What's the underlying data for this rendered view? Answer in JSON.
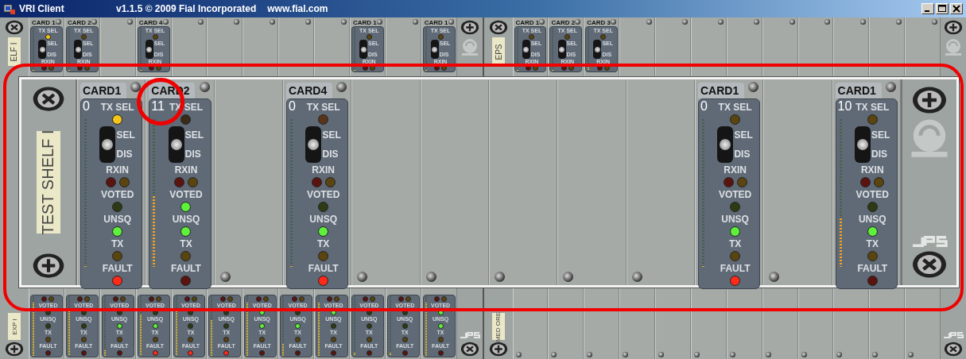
{
  "window": {
    "title": "VRI Client",
    "version": "v1.1.5  © 2009 Fial Incorporated",
    "website": "www.fial.com"
  },
  "background": {
    "top": [
      {
        "label": "ELF I",
        "slots": [
          {
            "kind": "card",
            "title": "CARD 1",
            "level": 0,
            "items": [
              {
                "kind": "label",
                "text": "TX SEL"
              },
              {
                "kind": "led",
                "color": "#f5c518"
              },
              {
                "kind": "switch",
                "level": 0.5,
                "labels": [
                  "SEL",
                  "DIS"
                ]
              },
              {
                "kind": "label",
                "text": "RXIN"
              },
              {
                "kind": "led_pair",
                "leds": [
                  {
                    "color": "#5a1410"
                  },
                  {
                    "color": "#5a4410"
                  }
                ]
              }
            ]
          },
          {
            "kind": "card",
            "title": "CARD 2",
            "level": 0,
            "items": [
              {
                "kind": "label",
                "text": "TX SEL"
              },
              {
                "kind": "led",
                "color": "#5a4410"
              },
              {
                "kind": "switch",
                "level": 0.5,
                "labels": [
                  "SEL",
                  "DIS"
                ]
              },
              {
                "kind": "label",
                "text": "RXIN"
              },
              {
                "kind": "led_pair",
                "leds": [
                  {
                    "color": "#5a1410"
                  },
                  {
                    "color": "#5a4410"
                  }
                ]
              }
            ]
          },
          {
            "kind": "empty"
          },
          {
            "kind": "card",
            "title": "CARD 4",
            "level": 0,
            "items": [
              {
                "kind": "label",
                "text": "TX SEL"
              },
              {
                "kind": "led",
                "color": "#5a4410"
              },
              {
                "kind": "switch",
                "level": 0.5,
                "labels": [
                  "SEL",
                  "DIS"
                ]
              },
              {
                "kind": "label",
                "text": "RXIN"
              },
              {
                "kind": "led_pair",
                "leds": [
                  {
                    "color": "#5a1410"
                  },
                  {
                    "color": "#5a4410"
                  }
                ]
              }
            ]
          },
          {
            "kind": "empty"
          },
          {
            "kind": "empty"
          },
          {
            "kind": "empty"
          },
          {
            "kind": "empty"
          },
          {
            "kind": "empty"
          },
          {
            "kind": "card",
            "title": "CARD 1",
            "level": 0,
            "items": [
              {
                "kind": "label",
                "text": "TX SEL"
              },
              {
                "kind": "led",
                "color": "#5a4410"
              },
              {
                "kind": "switch",
                "level": 0.5,
                "labels": [
                  "SEL",
                  "DIS"
                ]
              },
              {
                "kind": "label",
                "text": "RXIN"
              },
              {
                "kind": "led_pair",
                "leds": [
                  {
                    "color": "#5a1410"
                  },
                  {
                    "color": "#5a4410"
                  }
                ]
              }
            ]
          },
          {
            "kind": "empty"
          },
          {
            "kind": "card",
            "title": "CARD 1",
            "level": 0,
            "items": [
              {
                "kind": "label",
                "text": "TX SEL"
              },
              {
                "kind": "led",
                "color": "#5a4410"
              },
              {
                "kind": "switch",
                "level": 0.5,
                "labels": [
                  "SEL",
                  "DIS"
                ]
              },
              {
                "kind": "label",
                "text": "RXIN"
              },
              {
                "kind": "led_pair",
                "leds": [
                  {
                    "color": "#5a1410"
                  },
                  {
                    "color": "#5a4410"
                  }
                ]
              }
            ]
          }
        ]
      },
      {
        "label": "EPS",
        "slots": [
          {
            "kind": "card",
            "title": "CARD 1",
            "level": 0,
            "items": [
              {
                "kind": "label",
                "text": "TX SEL"
              },
              {
                "kind": "led",
                "color": "#5a4410"
              },
              {
                "kind": "switch",
                "level": 0.5,
                "labels": [
                  "SEL",
                  "DIS"
                ]
              },
              {
                "kind": "label",
                "text": "RXIN"
              },
              {
                "kind": "led_pair",
                "leds": [
                  {
                    "color": "#5a1410"
                  },
                  {
                    "color": "#5a4410"
                  }
                ]
              }
            ]
          },
          {
            "kind": "card",
            "title": "CARD 2",
            "level": 0,
            "items": [
              {
                "kind": "label",
                "text": "TX SEL"
              },
              {
                "kind": "led",
                "color": "#5a4410"
              },
              {
                "kind": "switch",
                "level": 0.5,
                "labels": [
                  "SEL",
                  "DIS"
                ]
              },
              {
                "kind": "label",
                "text": "RXIN"
              },
              {
                "kind": "led_pair",
                "leds": [
                  {
                    "color": "#5a1410"
                  },
                  {
                    "color": "#5a4410"
                  }
                ]
              }
            ]
          },
          {
            "kind": "card",
            "title": "CARD 3",
            "level": 0.15,
            "items": [
              {
                "kind": "label",
                "text": "TX SEL"
              },
              {
                "kind": "led",
                "color": "#5a4410"
              },
              {
                "kind": "switch",
                "level": 0.5,
                "labels": [
                  "SEL",
                  "DIS"
                ]
              },
              {
                "kind": "label",
                "text": "RXIN"
              },
              {
                "kind": "led_pair",
                "leds": [
                  {
                    "color": "#5a1410"
                  },
                  {
                    "color": "#5a4410"
                  }
                ]
              }
            ]
          },
          {
            "kind": "empty"
          },
          {
            "kind": "empty"
          },
          {
            "kind": "empty"
          },
          {
            "kind": "empty"
          },
          {
            "kind": "empty"
          },
          {
            "kind": "empty"
          },
          {
            "kind": "empty"
          },
          {
            "kind": "empty"
          },
          {
            "kind": "empty"
          }
        ]
      }
    ],
    "bottom": [
      {
        "label": "EXP I",
        "slots": [
          {
            "kind": "card",
            "level": 0.9,
            "items": [
              {
                "kind": "led_pair",
                "leds": [
                  {
                    "color": "#5a1410"
                  },
                  {
                    "color": "#5a4410"
                  }
                ]
              },
              {
                "kind": "label",
                "text": "VOTED"
              },
              {
                "kind": "led",
                "color": "#2e3a14"
              },
              {
                "kind": "label",
                "text": "UNSQ"
              },
              {
                "kind": "led",
                "color": "#2e3a14"
              },
              {
                "kind": "label",
                "text": "TX"
              },
              {
                "kind": "led",
                "color": "#5a4410"
              },
              {
                "kind": "label",
                "text": "FAULT"
              },
              {
                "kind": "led",
                "color": "#5a1410"
              }
            ]
          },
          {
            "kind": "card",
            "level": 0.8,
            "items": [
              {
                "kind": "led_pair",
                "leds": [
                  {
                    "color": "#5a1410"
                  },
                  {
                    "color": "#5a4410"
                  }
                ]
              },
              {
                "kind": "label",
                "text": "VOTED"
              },
              {
                "kind": "led",
                "color": "#2e3a14"
              },
              {
                "kind": "label",
                "text": "UNSQ"
              },
              {
                "kind": "led",
                "color": "#2e3a14"
              },
              {
                "kind": "label",
                "text": "TX"
              },
              {
                "kind": "led",
                "color": "#5a4410"
              },
              {
                "kind": "label",
                "text": "FAULT"
              },
              {
                "kind": "led",
                "color": "#5a1410"
              }
            ]
          },
          {
            "kind": "card",
            "level": 0.1,
            "items": [
              {
                "kind": "led_pair",
                "leds": [
                  {
                    "color": "#5a1410"
                  },
                  {
                    "color": "#5a4410"
                  }
                ]
              },
              {
                "kind": "label",
                "text": "VOTED"
              },
              {
                "kind": "led",
                "color": "#2e3a14"
              },
              {
                "kind": "label",
                "text": "UNSQ"
              },
              {
                "kind": "led",
                "color": "#5ef03a"
              },
              {
                "kind": "label",
                "text": "TX"
              },
              {
                "kind": "led",
                "color": "#5a4410"
              },
              {
                "kind": "label",
                "text": "FAULT"
              },
              {
                "kind": "led",
                "color": "#5a1410"
              }
            ]
          },
          {
            "kind": "card",
            "level": 0.7,
            "items": [
              {
                "kind": "led_pair",
                "leds": [
                  {
                    "color": "#5a1410"
                  },
                  {
                    "color": "#5a4410"
                  }
                ]
              },
              {
                "kind": "label",
                "text": "VOTED"
              },
              {
                "kind": "led",
                "color": "#2e3a14"
              },
              {
                "kind": "label",
                "text": "UNSQ"
              },
              {
                "kind": "led",
                "color": "#5ef03a"
              },
              {
                "kind": "label",
                "text": "TX"
              },
              {
                "kind": "led",
                "color": "#5a4410"
              },
              {
                "kind": "label",
                "text": "FAULT"
              },
              {
                "kind": "led",
                "color": "#ff2a1a"
              }
            ]
          },
          {
            "kind": "card",
            "level": 0.8,
            "items": [
              {
                "kind": "led_pair",
                "leds": [
                  {
                    "color": "#5a1410"
                  },
                  {
                    "color": "#5a4410"
                  }
                ]
              },
              {
                "kind": "label",
                "text": "VOTED"
              },
              {
                "kind": "led",
                "color": "#2e3a14"
              },
              {
                "kind": "label",
                "text": "UNSQ"
              },
              {
                "kind": "led",
                "color": "#2e3a14"
              },
              {
                "kind": "label",
                "text": "TX"
              },
              {
                "kind": "led",
                "color": "#5a4410"
              },
              {
                "kind": "label",
                "text": "FAULT"
              },
              {
                "kind": "led",
                "color": "#ff2a1a"
              }
            ]
          },
          {
            "kind": "card",
            "level": 0.6,
            "items": [
              {
                "kind": "led_pair",
                "leds": [
                  {
                    "color": "#5a1410"
                  },
                  {
                    "color": "#5a4410"
                  }
                ]
              },
              {
                "kind": "label",
                "text": "VOTED"
              },
              {
                "kind": "led",
                "color": "#2e3a14"
              },
              {
                "kind": "label",
                "text": "UNSQ"
              },
              {
                "kind": "led",
                "color": "#2e3a14"
              },
              {
                "kind": "label",
                "text": "TX"
              },
              {
                "kind": "led",
                "color": "#5a4410"
              },
              {
                "kind": "label",
                "text": "FAULT"
              },
              {
                "kind": "led",
                "color": "#ff2a1a"
              }
            ]
          },
          {
            "kind": "card",
            "level": 0.9,
            "items": [
              {
                "kind": "led_pair",
                "leds": [
                  {
                    "color": "#5a1410"
                  },
                  {
                    "color": "#5a4410"
                  }
                ]
              },
              {
                "kind": "label",
                "text": "VOTED"
              },
              {
                "kind": "led",
                "color": "#5ef03a"
              },
              {
                "kind": "label",
                "text": "UNSQ"
              },
              {
                "kind": "led",
                "color": "#5ef03a"
              },
              {
                "kind": "label",
                "text": "TX"
              },
              {
                "kind": "led",
                "color": "#5a4410"
              },
              {
                "kind": "label",
                "text": "FAULT"
              },
              {
                "kind": "led",
                "color": "#5a1410"
              }
            ]
          },
          {
            "kind": "card",
            "level": 0.2,
            "items": [
              {
                "kind": "led_pair",
                "leds": [
                  {
                    "color": "#5a1410"
                  },
                  {
                    "color": "#5a4410"
                  }
                ]
              },
              {
                "kind": "label",
                "text": "VOTED"
              },
              {
                "kind": "led",
                "color": "#2e3a14"
              },
              {
                "kind": "label",
                "text": "UNSQ"
              },
              {
                "kind": "led",
                "color": "#5ef03a"
              },
              {
                "kind": "label",
                "text": "TX"
              },
              {
                "kind": "led",
                "color": "#5a4410"
              },
              {
                "kind": "label",
                "text": "FAULT"
              },
              {
                "kind": "led",
                "color": "#5a1410"
              }
            ]
          },
          {
            "kind": "card",
            "level": 0.9,
            "items": [
              {
                "kind": "led_pair",
                "leds": [
                  {
                    "color": "#5a1410"
                  },
                  {
                    "color": "#5a4410"
                  }
                ]
              },
              {
                "kind": "label",
                "text": "VOTED"
              },
              {
                "kind": "led",
                "color": "#5ef03a"
              },
              {
                "kind": "label",
                "text": "UNSQ"
              },
              {
                "kind": "led",
                "color": "#2e3a14"
              },
              {
                "kind": "label",
                "text": "TX"
              },
              {
                "kind": "led",
                "color": "#5a4410"
              },
              {
                "kind": "label",
                "text": "FAULT"
              },
              {
                "kind": "led",
                "color": "#5a1410"
              }
            ]
          },
          {
            "kind": "card",
            "level": 0.05,
            "items": [
              {
                "kind": "led_pair",
                "leds": [
                  {
                    "color": "#5a1410"
                  },
                  {
                    "color": "#5a4410"
                  }
                ]
              },
              {
                "kind": "label",
                "text": "VOTED"
              },
              {
                "kind": "led",
                "color": "#2e3a14"
              },
              {
                "kind": "label",
                "text": "UNSQ"
              },
              {
                "kind": "led",
                "color": "#2e3a14"
              },
              {
                "kind": "label",
                "text": "TX"
              },
              {
                "kind": "led",
                "color": "#5a4410"
              },
              {
                "kind": "label",
                "text": "FAULT"
              },
              {
                "kind": "led",
                "color": "#5a1410"
              }
            ]
          },
          {
            "kind": "card",
            "level": 0.05,
            "items": [
              {
                "kind": "led_pair",
                "leds": [
                  {
                    "color": "#5a1410"
                  },
                  {
                    "color": "#5a4410"
                  }
                ]
              },
              {
                "kind": "label",
                "text": "VOTED"
              },
              {
                "kind": "led",
                "color": "#2e3a14"
              },
              {
                "kind": "label",
                "text": "UNSQ"
              },
              {
                "kind": "led",
                "color": "#2e3a14"
              },
              {
                "kind": "label",
                "text": "TX"
              },
              {
                "kind": "led",
                "color": "#5a4410"
              },
              {
                "kind": "label",
                "text": "FAULT"
              },
              {
                "kind": "led",
                "color": "#5a1410"
              }
            ]
          },
          {
            "kind": "card",
            "level": 0.9,
            "items": [
              {
                "kind": "led_pair",
                "leds": [
                  {
                    "color": "#5a1410"
                  },
                  {
                    "color": "#5a4410"
                  }
                ]
              },
              {
                "kind": "label",
                "text": "VOTED"
              },
              {
                "kind": "led",
                "color": "#5ef03a"
              },
              {
                "kind": "label",
                "text": "UNSQ"
              },
              {
                "kind": "led",
                "color": "#5ef03a"
              },
              {
                "kind": "label",
                "text": "TX"
              },
              {
                "kind": "led",
                "color": "#5a4410"
              },
              {
                "kind": "label",
                "text": "FAULT"
              },
              {
                "kind": "led",
                "color": "#5a1410"
              }
            ]
          }
        ]
      },
      {
        "label": "MED ORE",
        "slots": [
          {
            "kind": "empty"
          },
          {
            "kind": "empty"
          },
          {
            "kind": "empty"
          },
          {
            "kind": "empty"
          },
          {
            "kind": "empty"
          },
          {
            "kind": "empty"
          },
          {
            "kind": "empty"
          },
          {
            "kind": "empty"
          },
          {
            "kind": "empty"
          },
          {
            "kind": "empty"
          },
          {
            "kind": "empty"
          },
          {
            "kind": "empty"
          }
        ]
      }
    ]
  },
  "zoomed_shelf": {
    "label": "TEST SHELF I",
    "slots": [
      {
        "kind": "card",
        "title": "CARD1",
        "number": "0",
        "level": 0,
        "items": [
          {
            "kind": "label",
            "text": "TX SEL"
          },
          {
            "kind": "led",
            "color": "#f5c518"
          },
          {
            "kind": "switch",
            "level": 0.5,
            "labels": [
              "SEL",
              "DIS"
            ]
          },
          {
            "kind": "label",
            "text": "RXIN"
          },
          {
            "kind": "led_pair",
            "leds": [
              {
                "color": "#5a1410"
              },
              {
                "color": "#5a4410"
              }
            ]
          },
          {
            "kind": "label",
            "text": "VOTED"
          },
          {
            "kind": "led",
            "color": "#2e3a14"
          },
          {
            "kind": "label",
            "text": "UNSQ"
          },
          {
            "kind": "led",
            "color": "#5ef03a"
          },
          {
            "kind": "label",
            "text": "TX"
          },
          {
            "kind": "led",
            "color": "#5a4410"
          },
          {
            "kind": "label",
            "text": "FAULT"
          },
          {
            "kind": "led",
            "color": "#ff2a1a"
          }
        ]
      },
      {
        "kind": "card",
        "title": "CARD2",
        "number": "11",
        "level": 0.48,
        "items": [
          {
            "kind": "label",
            "text": "TX SEL"
          },
          {
            "kind": "led",
            "color": "#3a2a18"
          },
          {
            "kind": "switch",
            "level": 0.5,
            "labels": [
              "SEL",
              "DIS"
            ]
          },
          {
            "kind": "label",
            "text": "RXIN"
          },
          {
            "kind": "led_pair",
            "leds": [
              {
                "color": "#5a1410"
              },
              {
                "color": "#5a4410"
              }
            ]
          },
          {
            "kind": "label",
            "text": "VOTED"
          },
          {
            "kind": "led",
            "color": "#5ef03a"
          },
          {
            "kind": "label",
            "text": "UNSQ"
          },
          {
            "kind": "led",
            "color": "#5ef03a"
          },
          {
            "kind": "label",
            "text": "TX"
          },
          {
            "kind": "led",
            "color": "#5a4410"
          },
          {
            "kind": "label",
            "text": "FAULT"
          },
          {
            "kind": "led",
            "color": "#5a1410"
          }
        ]
      },
      {
        "kind": "empty"
      },
      {
        "kind": "card",
        "title": "CARD4",
        "number": "0",
        "level": 0,
        "items": [
          {
            "kind": "label",
            "text": "TX SEL"
          },
          {
            "kind": "led",
            "color": "#5a3418"
          },
          {
            "kind": "switch",
            "level": 0.5,
            "labels": [
              "SEL",
              "DIS"
            ]
          },
          {
            "kind": "label",
            "text": "RXIN"
          },
          {
            "kind": "led_pair",
            "leds": [
              {
                "color": "#5a1410"
              },
              {
                "color": "#5a4410"
              }
            ]
          },
          {
            "kind": "label",
            "text": "VOTED"
          },
          {
            "kind": "led",
            "color": "#2e3a14"
          },
          {
            "kind": "label",
            "text": "UNSQ"
          },
          {
            "kind": "led",
            "color": "#5ef03a"
          },
          {
            "kind": "label",
            "text": "TX"
          },
          {
            "kind": "led",
            "color": "#5a4410"
          },
          {
            "kind": "label",
            "text": "FAULT"
          },
          {
            "kind": "led",
            "color": "#ff2a1a"
          }
        ]
      },
      {
        "kind": "empty"
      },
      {
        "kind": "empty"
      },
      {
        "kind": "empty"
      },
      {
        "kind": "empty"
      },
      {
        "kind": "empty"
      },
      {
        "kind": "card",
        "title": "CARD1",
        "number": "0",
        "level": 0,
        "items": [
          {
            "kind": "label",
            "text": "TX SEL"
          },
          {
            "kind": "led",
            "color": "#5a4410"
          },
          {
            "kind": "switch",
            "level": 0.5,
            "labels": [
              "SEL",
              "DIS"
            ]
          },
          {
            "kind": "label",
            "text": "RXIN"
          },
          {
            "kind": "led_pair",
            "leds": [
              {
                "color": "#5a1410"
              },
              {
                "color": "#5a4410"
              }
            ]
          },
          {
            "kind": "label",
            "text": "VOTED"
          },
          {
            "kind": "led",
            "color": "#2e3a14"
          },
          {
            "kind": "label",
            "text": "UNSQ"
          },
          {
            "kind": "led",
            "color": "#5ef03a"
          },
          {
            "kind": "label",
            "text": "TX"
          },
          {
            "kind": "led",
            "color": "#5a4410"
          },
          {
            "kind": "label",
            "text": "FAULT"
          },
          {
            "kind": "led",
            "color": "#ff2a1a"
          }
        ]
      },
      {
        "kind": "empty"
      },
      {
        "kind": "card",
        "title": "CARD1",
        "number": "10",
        "level": 0.33,
        "items": [
          {
            "kind": "label",
            "text": "TX SEL"
          },
          {
            "kind": "led",
            "color": "#5a4410"
          },
          {
            "kind": "switch",
            "level": 0.5,
            "labels": [
              "SEL",
              "DIS"
            ]
          },
          {
            "kind": "label",
            "text": "RXIN"
          },
          {
            "kind": "led_pair",
            "leds": [
              {
                "color": "#5a1410"
              },
              {
                "color": "#5a4410"
              }
            ]
          },
          {
            "kind": "label",
            "text": "VOTED"
          },
          {
            "kind": "led",
            "color": "#2e3a14"
          },
          {
            "kind": "label",
            "text": "UNSQ"
          },
          {
            "kind": "led",
            "color": "#5ef03a"
          },
          {
            "kind": "label",
            "text": "TX"
          },
          {
            "kind": "led",
            "color": "#5a4410"
          },
          {
            "kind": "label",
            "text": "FAULT"
          },
          {
            "kind": "led",
            "color": "#5a1410"
          }
        ]
      }
    ]
  }
}
